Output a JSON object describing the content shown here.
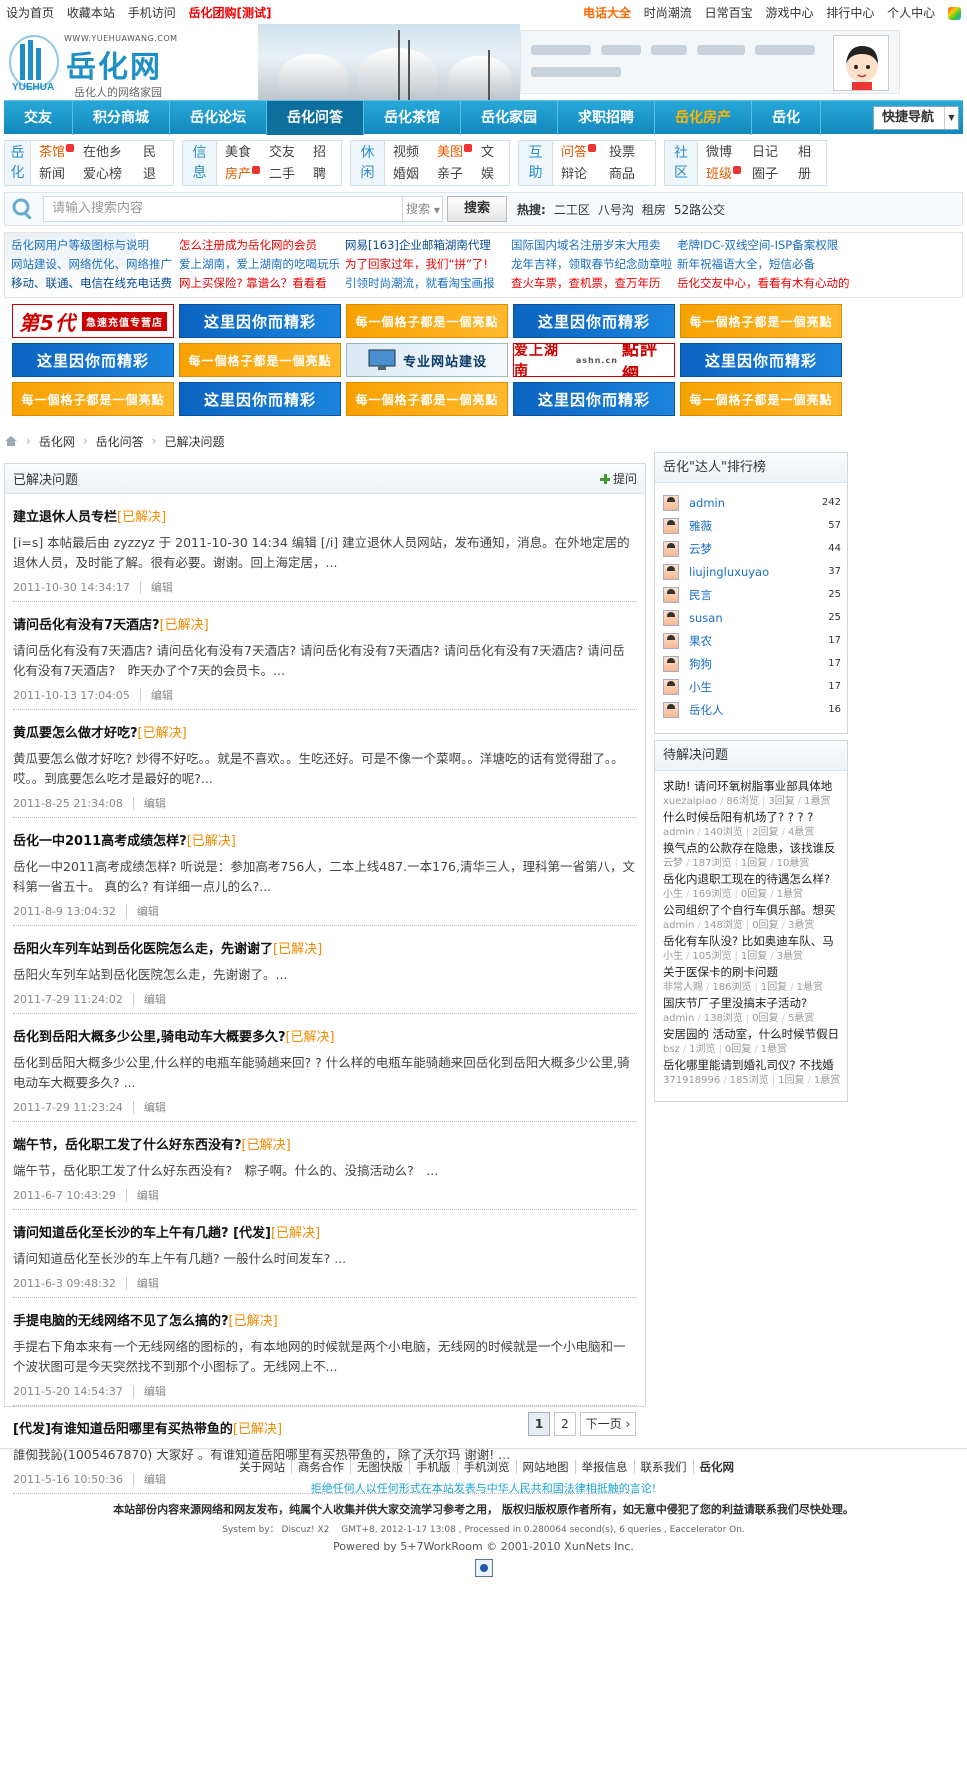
{
  "topbar": {
    "left": [
      "设为首页",
      "收藏本站",
      "手机访问"
    ],
    "left_highlight": "岳化团购[测试]",
    "right_highlight": "电话大全",
    "right": [
      "时尚潮流",
      "日常百宝",
      "游戏中心",
      "排行中心",
      "个人中心"
    ]
  },
  "logo": {
    "url": "WWW.YUEHUAWANG.COM",
    "name": "岳化网",
    "slogan": "岳化人的网络家园",
    "mark": "YUEHUA"
  },
  "nav": {
    "items": [
      "交友",
      "积分商城",
      "岳化论坛",
      "岳化问答",
      "岳化茶馆",
      "岳化家园",
      "求职招聘",
      "岳化房产",
      "岳化"
    ],
    "active_index": 3,
    "quick_label": "快捷导航"
  },
  "cats": [
    {
      "title": [
        "岳",
        "化"
      ],
      "links": [
        "茶馆",
        "在他乡",
        "民",
        "新闻",
        "爱心榜",
        "退"
      ]
    },
    {
      "title": [
        "信",
        "息"
      ],
      "links": [
        "美食",
        "交友",
        "招",
        "房产",
        "二手",
        "聘"
      ]
    },
    {
      "title": [
        "休",
        "闲"
      ],
      "links": [
        "视频",
        "美图",
        "文",
        "婚姻",
        "亲子",
        "娱"
      ]
    },
    {
      "title": [
        "互",
        "助"
      ],
      "links": [
        "问答",
        "投票",
        "辩论",
        "商品"
      ]
    },
    {
      "title": [
        "社",
        "区"
      ],
      "links": [
        "微博",
        "日记",
        "相",
        "班级",
        "圈子",
        "册"
      ]
    }
  ],
  "search": {
    "placeholder": "请输入搜索内容",
    "select": "搜索",
    "button": "搜索",
    "hot_label": "热搜:",
    "keywords": [
      "二工区",
      "八号沟",
      "租房",
      "52路公交"
    ]
  },
  "textlinks": [
    [
      "岳化网用户等级图标与说明",
      "网站建设、网络优化、网络推广",
      "移动、联通、电信在线充电话费"
    ],
    [
      "怎么注册成为岳化网的会员",
      "爱上湖南，爱上湖南的吃喝玩乐",
      "网上买保险? 靠谱么？看看看"
    ],
    [
      "网易[163]企业邮箱湖南代理",
      "为了回家过年，我们“拼”了!",
      "引领时尚潮流，就看淘宝画报"
    ],
    [
      "国际国内域名注册岁末大甩卖",
      "龙年吉祥，领取春节纪念勋章啦",
      "查火车票，查机票，查万年历"
    ],
    [
      "老牌IDC-双线空间-ISP备案权限",
      "新年祝福语大全，短信必备",
      "岳化交友中心，看看有木有心动的"
    ]
  ],
  "ads": {
    "blue": "这里因你而精彩",
    "orange": "每一個格子都是一個亮點",
    "fifth": "第5代",
    "fifth_sub": "急速充值专营店",
    "web": "专业网站建设",
    "dian_pre": "爱上湖南",
    "dian": "點評網",
    "dian_url": "ashn.cn"
  },
  "crumb": [
    "岳化网",
    "岳化问答",
    "已解决问题"
  ],
  "main": {
    "title": "已解决问题",
    "ask": "提问",
    "edit_label": "编辑",
    "threads": [
      {
        "title": "建立退休人员专栏",
        "tag": "[已解决]",
        "excerpt": "[i=s] 本帖最后由 zyzzyz 于 2011-10-30 14:34 编辑 [/i] 建立退休人员网站，发布通知，消息。在外地定居的退休人员，及时能了解。很有必要。谢谢。回上海定居，...",
        "date": "2011-10-30 14:34:17"
      },
      {
        "title": "请问岳化有没有7天酒店?",
        "tag": "[已解决]",
        "excerpt": "请问岳化有没有7天酒店? 请问岳化有没有7天酒店? 请问岳化有没有7天酒店? 请问岳化有没有7天酒店? 请问岳化有没有7天酒店?　昨天办了个7天的会员卡。...",
        "date": "2011-10-13 17:04:05"
      },
      {
        "title": "黄瓜要怎么做才好吃?",
        "tag": "[已解决]",
        "excerpt": "黄瓜要怎么做才好吃? 炒得不好吃。。就是不喜欢。。生吃还好。可是不像一个菜啊。。洋塘吃的话有觉得甜了。。哎。。到底要怎么吃才是最好的呢?...",
        "date": "2011-8-25 21:34:08"
      },
      {
        "title": "岳化一中2011高考成绩怎样?",
        "tag": "[已解决]",
        "excerpt": "岳化一中2011高考成绩怎样? 听说是：参加高考756人，二本上线487.一本176,清华三人，理科第一省第八，文科第一省五十。 真的么? 有详细一点儿的么?...",
        "date": "2011-8-9 13:04:32"
      },
      {
        "title": "岳阳火车列车站到岳化医院怎么走，先谢谢了",
        "tag": "[已解决]",
        "excerpt": "岳阳火车列车站到岳化医院怎么走，先谢谢了。...",
        "date": "2011-7-29 11:24:02"
      },
      {
        "title": "岳化到岳阳大概多少公里,骑电动车大概要多久?",
        "tag": "[已解决]",
        "excerpt": "岳化到岳阳大概多少公里,什么样的电瓶车能骑趟来回? ? 什么样的电瓶车能骑趟来回岳化到岳阳大概多少公里,骑电动车大概要多久? ...",
        "date": "2011-7-29 11:23:24"
      },
      {
        "title": "端午节，岳化职工发了什么好东西没有?",
        "tag": "[已解决]",
        "excerpt": "端午节，岳化职工发了什么好东西没有?　粽子啊。什么的、没搞活动么?　...",
        "date": "2011-6-7 10:43:29"
      },
      {
        "title": "请问知道岳化至长沙的车上午有几趟? [代发]",
        "tag": "[已解决]",
        "excerpt": "请问知道岳化至长沙的车上午有几趟? 一般什么时间发车? ...",
        "date": "2011-6-3 09:48:32"
      },
      {
        "title": "手提电脑的无线网络不见了怎么搞的?",
        "tag": "[已解决]",
        "excerpt": "手提右下角本来有一个无线网络的图标的，有本地网的时候就是两个小电脑，无线网的时候就是一个小电脑和一个波状图可是今天突然找不到那个小图标了。无线网上不...",
        "date": "2011-5-20 14:54:37"
      },
      {
        "title": "[代发]有谁知道岳阳哪里有买热带鱼的",
        "tag": "[已解决]",
        "excerpt": "誰倁我訫(1005467870) 大家好 。有谁知道岳阳哪里有买热带鱼的，除了沃尔玛 谢谢! ...",
        "date": "2011-5-16 10:50:36"
      }
    ]
  },
  "pager": {
    "current": "1",
    "next_num": "2",
    "next": "下一页"
  },
  "rank": {
    "title": "岳化\"达人\"排行榜",
    "rows": [
      {
        "name": "admin",
        "count": "242"
      },
      {
        "name": "雅薇",
        "count": "57"
      },
      {
        "name": "云梦",
        "count": "44"
      },
      {
        "name": "liujingluxuyao",
        "count": "37"
      },
      {
        "name": "民言",
        "count": "25"
      },
      {
        "name": "susan",
        "count": "25"
      },
      {
        "name": "果农",
        "count": "17"
      },
      {
        "name": "狗狗",
        "count": "17"
      },
      {
        "name": "小生",
        "count": "17"
      },
      {
        "name": "岳化人",
        "count": "16"
      }
    ]
  },
  "pending": {
    "title": "待解决问题",
    "items": [
      {
        "q": "求助! 请问环氧树脂事业部具体地",
        "user": "xuezaipiao",
        "views": "86浏览",
        "replies": "3回复",
        "reward": "1悬赏"
      },
      {
        "q": "什么时候岳阳有机场了? ? ? ?",
        "user": "admin",
        "views": "140浏览",
        "replies": "2回复",
        "reward": "4悬赏"
      },
      {
        "q": "换气点的公款存在隐患，该找谁反",
        "user": "云梦",
        "views": "187浏览",
        "replies": "1回复",
        "reward": "10悬赏"
      },
      {
        "q": "岳化内退职工现在的待遇怎么样?",
        "user": "小生",
        "views": "169浏览",
        "replies": "0回复",
        "reward": "1悬赏"
      },
      {
        "q": "公司组织了个自行车俱乐部。想买",
        "user": "admin",
        "views": "148浏览",
        "replies": "0回复",
        "reward": "3悬赏"
      },
      {
        "q": "岳化有车队没? 比如奥迪车队、马",
        "user": "小生",
        "views": "105浏览",
        "replies": "1回复",
        "reward": "3悬赏"
      },
      {
        "q": "关于医保卡的刷卡问题",
        "user": "非常人赐",
        "views": "186浏览",
        "replies": "1回复",
        "reward": "1悬赏"
      },
      {
        "q": "国庆节厂子里没搞末子活动?",
        "user": "admin",
        "views": "138浏览",
        "replies": "0回复",
        "reward": "5悬赏"
      },
      {
        "q": "安居园的 活动室，什么时候节假日",
        "user": "bsz",
        "views": "1浏览",
        "replies": "0回复",
        "reward": "1悬赏"
      },
      {
        "q": "岳化哪里能请到婚礼司仪? 不找婚",
        "user": "371918996",
        "views": "185浏览",
        "replies": "1回复",
        "reward": "1悬赏"
      }
    ]
  },
  "footer": {
    "links": [
      "关于网站",
      "商务合作",
      "无图快版",
      "手机版",
      "手机浏览",
      "网站地图",
      "举报信息",
      "联系我们"
    ],
    "brand": "岳化网",
    "warn": "拒绝任何人以任何形式在本站发表与中华人民共和国法律相抵触的言论!",
    "note": "本站部份内容来源网络和网友发布，纯属个人收集并供大家交流学习参考之用， 版权归版权原作者所有，如无意中侵犯了您的利益请联系我们尽快处理。",
    "sys": "System by： Discuz! X2 　GMT+8, 2012-1-17 13:08 , Processed in 0.280064 second(s), 6 queries , Eaccelerator On.",
    "powered": "Powered by 5+7WorkRoom © 2001-2010 XunNets Inc."
  },
  "colors": {
    "nav": "#1288bd",
    "solved": "#f08a00",
    "link": "#1a6fc4"
  }
}
